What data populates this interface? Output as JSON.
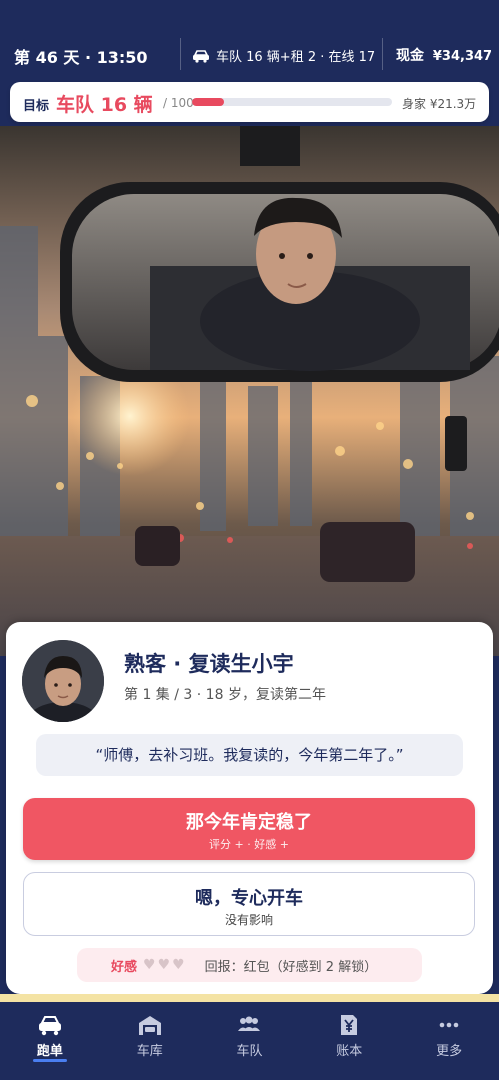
{
  "status": {
    "day": "第 46 天 · 13:50",
    "fleet": "车队 16 辆+租 2 · 在线 17",
    "cash_label": "现金",
    "cash_value": "¥34,347"
  },
  "goal": {
    "label": "目标",
    "title": "车队 16 辆",
    "total": "/ 100",
    "progress_fraction": 0.16,
    "net_worth": "身家 ¥21.3万"
  },
  "passenger": {
    "name": "熟客 · 复读生小宇",
    "info": "第 1 集 / 3 · 18 岁，复读第二年",
    "quote": "“师傅，去补习班。我复读的，今年第二年了。”"
  },
  "choices": [
    {
      "label": "那今年肯定稳了",
      "effect": "评分 + · 好感 +"
    },
    {
      "label": "嗯，专心开车",
      "effect": "没有影响"
    }
  ],
  "favor": {
    "label": "好感",
    "hearts": "♥♥♥",
    "reward": "回报：红包（好感到 2 解锁）"
  },
  "nav": [
    {
      "label": "跑单",
      "icon": "car-icon",
      "active": true
    },
    {
      "label": "车库",
      "icon": "garage-icon",
      "active": false
    },
    {
      "label": "车队",
      "icon": "team-icon",
      "active": false
    },
    {
      "label": "账本",
      "icon": "ledger-icon",
      "active": false
    },
    {
      "label": "更多",
      "icon": "more-icon",
      "active": false
    }
  ],
  "colors": {
    "navy": "#1e2b5c",
    "accent_red": "#e84a5f",
    "button_red": "#f05663",
    "active_underline": "#4a7ef0"
  }
}
